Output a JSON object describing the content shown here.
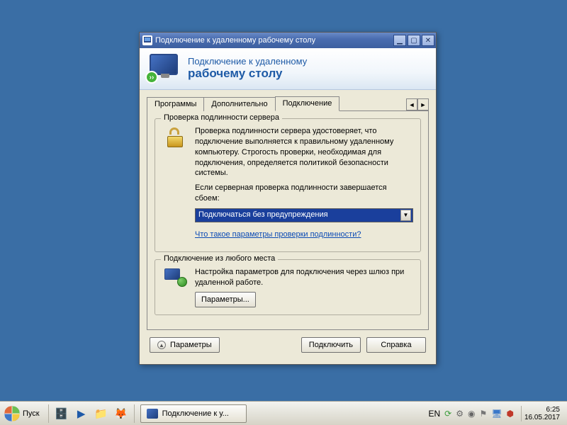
{
  "window": {
    "title": "Подключение к удаленному рабочему столу",
    "banner_line1": "Подключение к удаленному",
    "banner_line2": "рабочему столу"
  },
  "tabs": {
    "items": [
      "Программы",
      "Дополнительно",
      "Подключение"
    ],
    "active_index": 2
  },
  "auth_group": {
    "legend": "Проверка подлинности сервера",
    "paragraph1": "Проверка подлинности сервера удостоверяет, что подключение выполняется к правильному удаленному компьютеру. Строгость проверки, необходимая для подключения, определяется политикой безопасности системы.",
    "paragraph2": "Если серверная проверка подлинности завершается сбоем:",
    "combo_value": "Подключаться без предупреждения",
    "help_link": "Что такое параметры проверки подлинности?"
  },
  "anywhere_group": {
    "legend": "Подключение из любого места",
    "paragraph": "Настройка параметров для подключения через шлюз при удаленной работе.",
    "button": "Параметры..."
  },
  "dialog_buttons": {
    "options": "Параметры",
    "connect": "Подключить",
    "help": "Справка"
  },
  "taskbar": {
    "start": "Пуск",
    "task_label": "Подключение к у...",
    "lang": "EN",
    "time": "6:25",
    "date": "16.05.2017"
  }
}
